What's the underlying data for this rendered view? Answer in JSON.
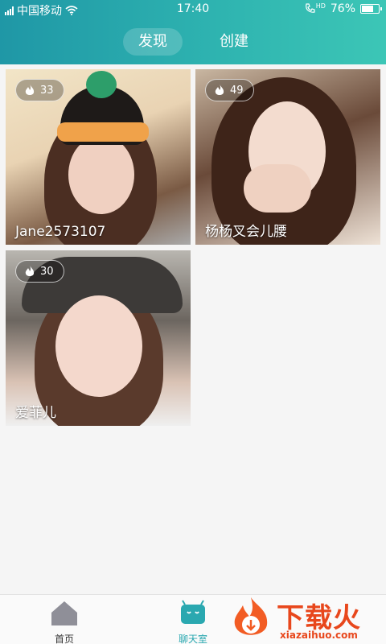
{
  "status_bar": {
    "carrier": "中国移动",
    "time": "17:40",
    "network_badge": "HD",
    "battery_percent": "76%",
    "battery_level": 0.76
  },
  "tabs": [
    {
      "label": "发现",
      "active": true
    },
    {
      "label": "创建",
      "active": false
    }
  ],
  "cards": [
    {
      "hot_count": "33",
      "name": "Jane2573107"
    },
    {
      "hot_count": "49",
      "name": "杨杨叉会儿腰"
    },
    {
      "hot_count": "30",
      "name": "爱菲儿"
    }
  ],
  "bottom_nav": [
    {
      "label": "首页",
      "icon": "home-icon"
    },
    {
      "label": "聊天室",
      "icon": "chatroom-icon",
      "active": true
    }
  ],
  "watermark": {
    "title": "下载火",
    "subtitle": "xiazaihuo.com"
  },
  "colors": {
    "header_gradient_start": "#1f97a6",
    "header_gradient_end": "#3cc6b6",
    "active_nav": "#2aa8b0",
    "watermark": "#e8471c"
  }
}
